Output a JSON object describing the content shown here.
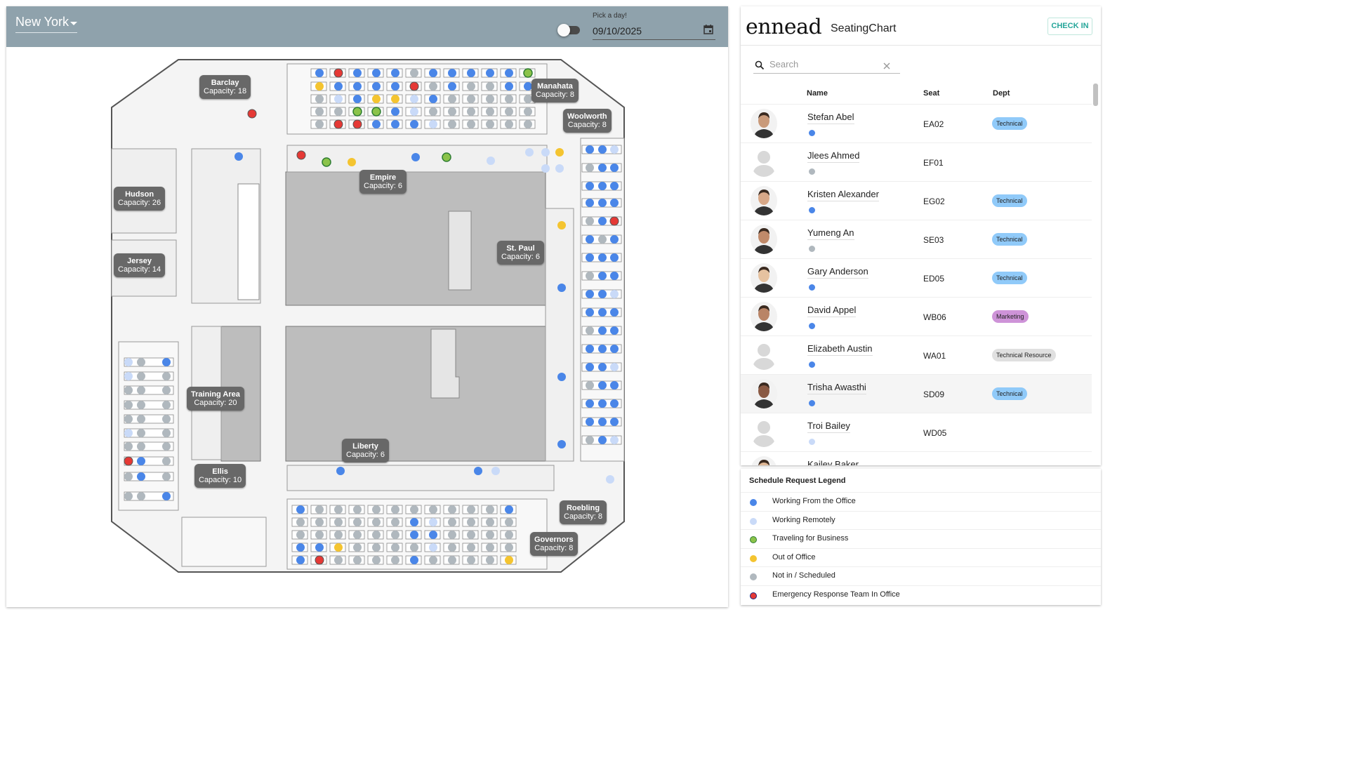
{
  "header": {
    "location": "New York",
    "date_label": "Pick a day!",
    "date_value": "09/10/2025"
  },
  "rooms": [
    {
      "name": "Barclay",
      "capacity": "Capacity: 18"
    },
    {
      "name": "Manahata",
      "capacity": "Capacity: 8"
    },
    {
      "name": "Woolworth",
      "capacity": "Capacity: 8"
    },
    {
      "name": "Hudson",
      "capacity": "Capacity: 26"
    },
    {
      "name": "Empire",
      "capacity": "Capacity: 6"
    },
    {
      "name": "Jersey",
      "capacity": "Capacity: 14"
    },
    {
      "name": "St. Paul",
      "capacity": "Capacity: 6"
    },
    {
      "name": "Training Area",
      "capacity": "Capacity: 20"
    },
    {
      "name": "Liberty",
      "capacity": "Capacity: 6"
    },
    {
      "name": "Ellis",
      "capacity": "Capacity: 10"
    },
    {
      "name": "Roebling",
      "capacity": "Capacity: 8"
    },
    {
      "name": "Governors",
      "capacity": "Capacity: 8"
    }
  ],
  "sidebar": {
    "brand": "ennead",
    "app_name": "SeatingChart",
    "check_in": "CHECK IN",
    "search_placeholder": "Search",
    "columns": {
      "name": "Name",
      "seat": "Seat",
      "dept": "Dept"
    }
  },
  "people": [
    {
      "name": "Stefan Abel",
      "seat": "EA02",
      "dept": "Technical",
      "status": "office",
      "photo": "photo"
    },
    {
      "name": "Jlees Ahmed",
      "seat": "EF01",
      "dept": "",
      "status": "notin",
      "photo": "placeholder"
    },
    {
      "name": "Kristen Alexander",
      "seat": "EG02",
      "dept": "Technical",
      "status": "office",
      "photo": "photo"
    },
    {
      "name": "Yumeng An",
      "seat": "SE03",
      "dept": "Technical",
      "status": "notin",
      "photo": "photo"
    },
    {
      "name": "Gary Anderson",
      "seat": "ED05",
      "dept": "Technical",
      "status": "office",
      "photo": "photo"
    },
    {
      "name": "David Appel",
      "seat": "WB06",
      "dept": "Marketing",
      "status": "office",
      "photo": "photo"
    },
    {
      "name": "Elizabeth Austin",
      "seat": "WA01",
      "dept": "Technical Resource",
      "status": "office",
      "photo": "placeholder"
    },
    {
      "name": "Trisha Awasthi",
      "seat": "SD09",
      "dept": "Technical",
      "status": "office",
      "photo": "photo"
    },
    {
      "name": "Troi Bailey",
      "seat": "WD05",
      "dept": "",
      "status": "remote",
      "photo": "placeholder"
    },
    {
      "name": "Kailey Baker",
      "seat": "",
      "dept": "",
      "status": "office",
      "photo": "photo"
    }
  ],
  "legend": {
    "title": "Schedule Request Legend",
    "items": [
      {
        "label": "Working From the Office",
        "color": "#4a86e8"
      },
      {
        "label": "Working Remotely",
        "color": "#c9daf8"
      },
      {
        "label": "Traveling for Business",
        "color": "#8bc34a"
      },
      {
        "label": "Out of Office",
        "color": "#f4c430"
      },
      {
        "label": "Not in / Scheduled",
        "color": "#b0b8be"
      },
      {
        "label": "Emergency Response Team In Office",
        "color": "#e53935"
      }
    ]
  },
  "colors": {
    "topbar": "#8fa2ac",
    "office": "#4a86e8",
    "remote": "#c9daf8",
    "travel": "#8bc34a",
    "out": "#f4c430",
    "notin": "#b0b8be",
    "emergency": "#e53935",
    "chip_technical": "#90caf9",
    "chip_marketing": "#ce93d8",
    "chip_resource": "#e0e0e0"
  }
}
